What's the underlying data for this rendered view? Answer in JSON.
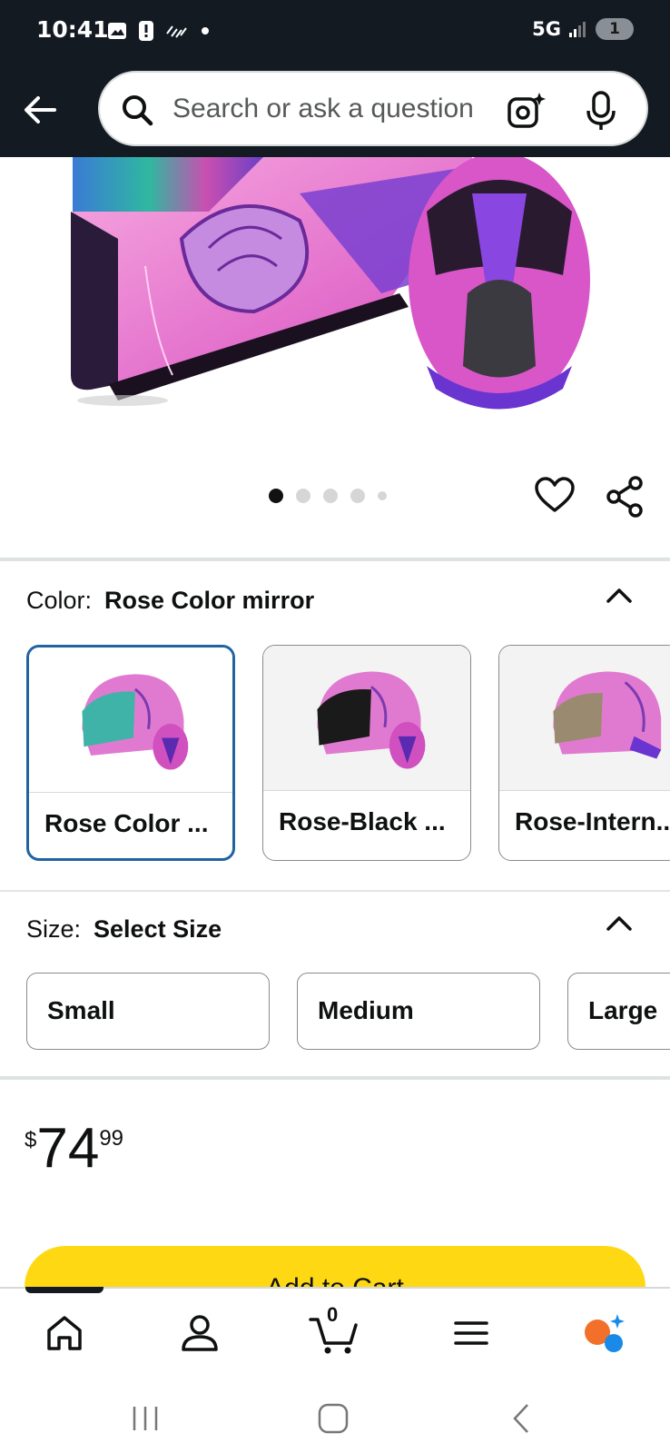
{
  "status_bar": {
    "time": "10:41",
    "network": "5G",
    "battery_label": "1"
  },
  "search": {
    "placeholder": "Search or ask a question"
  },
  "gallery": {
    "image_count": 5,
    "active_index": 0
  },
  "color": {
    "label": "Color:",
    "selected": "Rose Color mirror",
    "options": [
      {
        "label": "Rose Color ...",
        "visor": "#3fb3a8"
      },
      {
        "label": "Rose-Black ...",
        "visor": "#1a1a1a"
      },
      {
        "label": "Rose-Intern...",
        "visor": "#9a8a70"
      }
    ]
  },
  "size": {
    "label": "Size:",
    "selected": "Select Size",
    "options": [
      "Small",
      "Medium",
      "Large"
    ]
  },
  "price": {
    "symbol": "$",
    "whole": "74",
    "fraction": "99"
  },
  "cart": {
    "button_label": "Add to Cart"
  },
  "bottom_nav": {
    "cart_count": "0",
    "items": [
      "home-icon",
      "account-icon",
      "cart-icon",
      "menu-icon",
      "rufus-icon"
    ]
  },
  "colors": {
    "header_bg": "#131a22",
    "cart_button": "#ffd814",
    "selected_border": "#2162a1"
  }
}
